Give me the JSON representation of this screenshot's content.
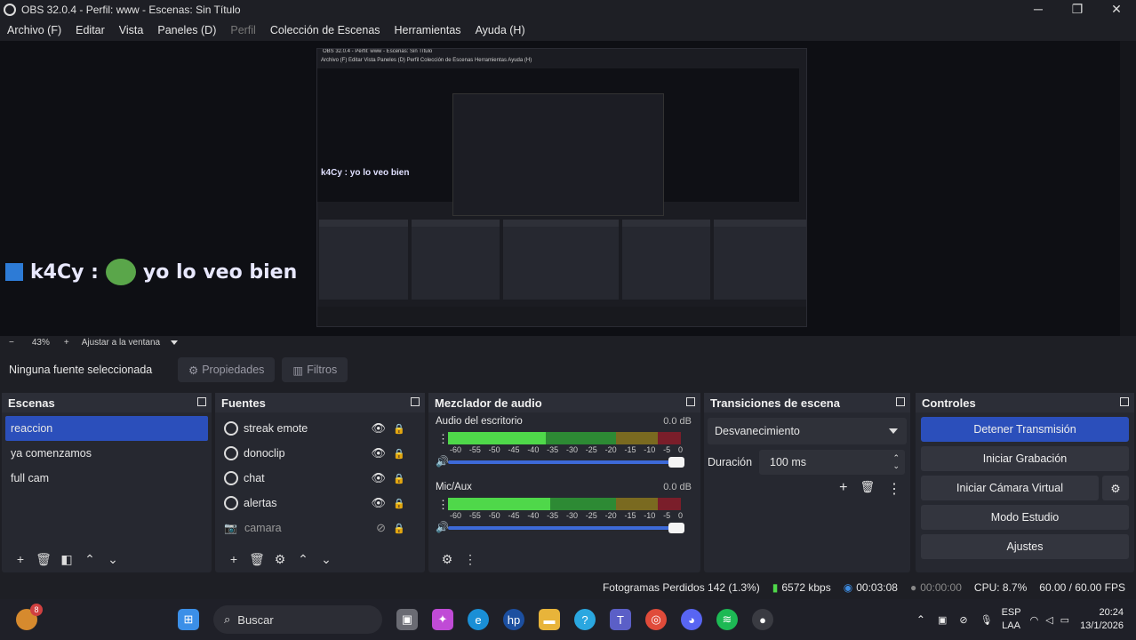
{
  "window": {
    "title": "OBS 32.0.4 - Perfil: www - Escenas: Sin Título",
    "minimize": "─",
    "maximize": "❐",
    "close": "✕"
  },
  "menu": [
    "Archivo (F)",
    "Editar",
    "Vista",
    "Paneles (D)",
    "Perfil",
    "Colección de Escenas",
    "Herramientas",
    "Ayuda (H)"
  ],
  "preview": {
    "chat_user": "k4Cy :",
    "chat_msg": "yo lo veo bien",
    "nested_title": "OBS 32.0.4 - Perfil: www - Escenas: Sin Título",
    "nested_menu": "Archivo (F)   Editar   Vista   Paneles (D)   Perfil   Colección de Escenas   Herramientas   Ayuda (H)"
  },
  "zoom": {
    "minus": "−",
    "level": "43%",
    "plus": "+",
    "fit": "Ajustar a la ventana"
  },
  "sourcebar": {
    "no_source": "Ninguna fuente seleccionada",
    "properties": "Propiedades",
    "filters": "Filtros"
  },
  "scenes": {
    "title": "Escenas",
    "items": [
      "reaccion",
      "ya comenzamos",
      "full cam"
    ]
  },
  "sources": {
    "title": "Fuentes",
    "items": [
      "streak emote",
      "donoclip",
      "chat",
      "alertas",
      "camara"
    ]
  },
  "mixer": {
    "title": "Mezclador de audio",
    "channels": [
      {
        "name": "Audio del escritorio",
        "db": "0.0 dB"
      },
      {
        "name": "Mic/Aux",
        "db": "0.0 dB"
      }
    ],
    "ticks": [
      "-60",
      "-55",
      "-50",
      "-45",
      "-40",
      "-35",
      "-30",
      "-25",
      "-20",
      "-15",
      "-10",
      "-5",
      "0"
    ]
  },
  "transitions": {
    "title": "Transiciones de escena",
    "selected": "Desvanecimiento",
    "duration_label": "Duración",
    "duration_value": "100 ms"
  },
  "controls": {
    "title": "Controles",
    "stop_stream": "Detener Transmisión",
    "start_recording": "Iniciar Grabación",
    "start_virtualcam": "Iniciar Cámara Virtual",
    "studio_mode": "Modo Estudio",
    "settings": "Ajustes"
  },
  "status": {
    "dropped": "Fotogramas Perdidos 142 (1.3%)",
    "bitrate": "6572 kbps",
    "stream_time": "00:03:08",
    "rec_time": "00:00:00",
    "cpu": "CPU: 8.7%",
    "fps": "60.00 / 60.00 FPS"
  },
  "taskbar": {
    "search": "Buscar",
    "lang1": "ESP",
    "lang2": "LAA",
    "time": "20:24",
    "date": "13/1/2026",
    "badge": "8"
  },
  "colors": {
    "accent": "#2b4fbb",
    "panel": "#262830",
    "bg": "#1e1f25"
  }
}
